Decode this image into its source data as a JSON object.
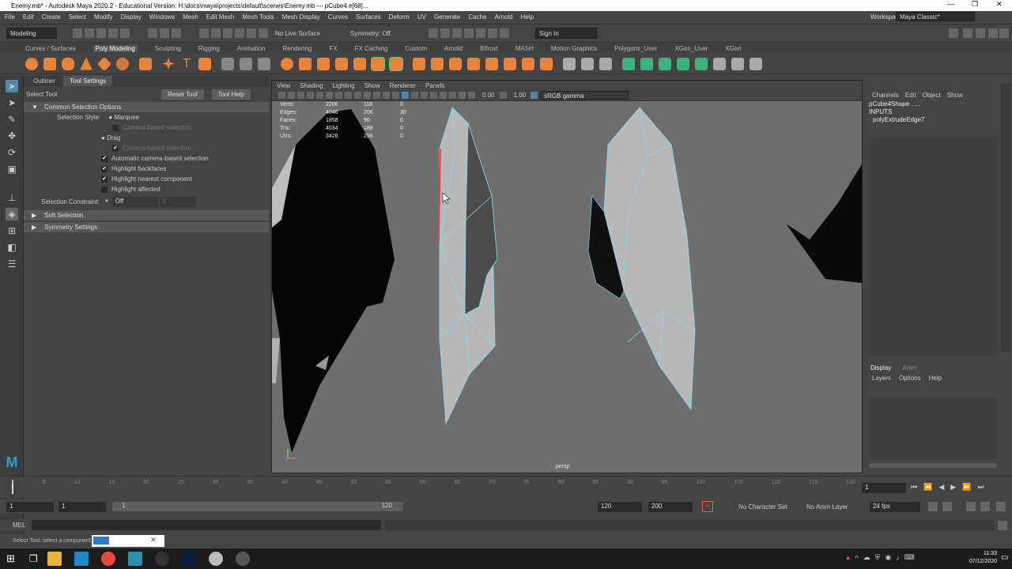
{
  "title": "Enemy.mb* - Autodesk Maya 2020.2 - Educational Version: H:\\docs\\maya\\projects\\default\\scenes\\Enemy.mb  ---  pCube4.e[68]...",
  "menu": [
    "File",
    "Edit",
    "Create",
    "Select",
    "Modify",
    "Display",
    "Windows",
    "Mesh",
    "Edit Mesh",
    "Mesh Tools",
    "Mesh Display",
    "Curves",
    "Surfaces",
    "Deform",
    "UV",
    "Generate",
    "Cache",
    "Arnold",
    "Help"
  ],
  "workspace": {
    "label": "Workspace :",
    "value": "Maya Classic*"
  },
  "status": {
    "mode": "Modeling",
    "live": "No Live Surface",
    "symmetry": "Symmetry: Off",
    "signin": "Sign In"
  },
  "shelf_tabs": [
    "Curves / Surfaces",
    "Poly Modeling",
    "Sculpting",
    "Rigging",
    "Animation",
    "Rendering",
    "FX",
    "FX Caching",
    "Custom",
    "Arnold",
    "Bifrost",
    "MASH",
    "Motion Graphics",
    "Polygons_User",
    "XGen_User",
    "XGen"
  ],
  "panel": {
    "tabs": [
      "Outliner",
      "Tool Settings"
    ],
    "tool": "Select Tool",
    "reset": "Reset Tool",
    "help": "Tool Help",
    "common": "Common Selection Options",
    "style_label": "Selection Style:",
    "marquee": "Marquee",
    "camera_based": "Camera-based selection",
    "drag": "Drag",
    "camera_based2": "Camera-based selection",
    "auto_cam": "Automatic camera-based selection",
    "hl_back": "Highlight backfaces",
    "hl_near": "Highlight nearest component",
    "hl_aff": "Highlight affected",
    "constraint_label": "Selection Constraint:",
    "constraint": "Off",
    "constraint_val": "0",
    "soft": "Soft Selection",
    "symm": "Symmetry Settings"
  },
  "viewport": {
    "menu": [
      "View",
      "Shading",
      "Lighting",
      "Show",
      "Renderer",
      "Panels"
    ],
    "exposure": "0.00",
    "gamma": "1.00",
    "colorspace": "sRGB gamma",
    "camera": "persp",
    "hud": [
      [
        "Verts:",
        "2206",
        "118",
        "0"
      ],
      [
        "Edges:",
        "4046",
        "206",
        "30"
      ],
      [
        "Faces:",
        "1858",
        "90",
        "0"
      ],
      [
        "Tris:",
        "4034",
        "188",
        "0"
      ],
      [
        "UVs:",
        "3426",
        "256",
        "0"
      ]
    ]
  },
  "channel": {
    "menu": [
      "Channels",
      "Edit",
      "Object",
      "Show"
    ],
    "shape": "pCube4Shape . . .",
    "inputs": "INPUTS",
    "node": "polyExtrudeEdge7"
  },
  "layers": {
    "tabs": [
      "Display",
      "Anim"
    ],
    "menu": [
      "Layers",
      "Options",
      "Help"
    ]
  },
  "timeline": {
    "ticks": [
      "1",
      "5",
      "10",
      "15",
      "20",
      "25",
      "30",
      "35",
      "40",
      "45",
      "50",
      "55",
      "60",
      "65",
      "70",
      "75",
      "80",
      "85",
      "90",
      "95",
      "100",
      "105",
      "110",
      "115",
      "120"
    ],
    "current": "1"
  },
  "range": {
    "start": "1",
    "start2": "1",
    "bar_start": "1",
    "bar_end": "120",
    "end": "120",
    "end2": "200",
    "char": "No Character Set",
    "anim": "No Anim Layer",
    "fps": "24 fps"
  },
  "cmd": {
    "label": "MEL"
  },
  "help": "Select Tool: select a component",
  "clock": {
    "time": "11:33",
    "date": "07/12/2020"
  }
}
